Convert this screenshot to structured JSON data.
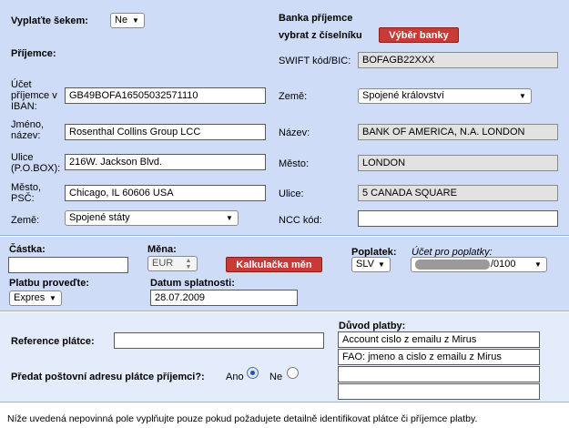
{
  "top": {
    "pay_by_check_label": "Vyplaťte šekem:",
    "pay_by_check_value": "Ne",
    "recipient_heading": "Příjemce:",
    "account_label": "Účet příjemce v IBAN:",
    "account_value": "GB49BOFA16505032571110",
    "name_label": "Jméno, název:",
    "name_value": "Rosenthal Collins Group LCC",
    "street_label": "Ulice (P.O.BOX):",
    "street_value": "216W. Jackson Blvd.",
    "city_label": "Město, PSČ:",
    "city_value": "Chicago, IL 60606 USA",
    "country_label": "Země:",
    "country_value": "Spojené státy"
  },
  "bank": {
    "heading_line1": "Banka příjemce",
    "heading_line2": "vybrat z číselníku",
    "select_bank_button": "Výběr banky",
    "swift_label": "SWIFT kód/BIC:",
    "swift_value": "BOFAGB22XXX",
    "country_label": "Země:",
    "country_value": "Spojené království",
    "name_label": "Název:",
    "name_value": "BANK OF AMERICA, N.A. LONDON",
    "city_label": "Město:",
    "city_value": "LONDON",
    "street_label": "Ulice:",
    "street_value": "5 CANADA SQUARE",
    "ncc_label": "NCC kód:",
    "ncc_value": ""
  },
  "amount": {
    "amount_label": "Částka:",
    "amount_value": "",
    "currency_label": "Měna:",
    "currency_value": "EUR",
    "calculator_button": "Kalkulačka měn",
    "fee_label": "Poplatek:",
    "fee_value": "SLV",
    "fee_account_label": "Účet pro poplatky:",
    "fee_account_value": "/0100",
    "execute_label": "Platbu proveďte:",
    "execute_value": "Expres",
    "due_date_label": "Datum splatnosti:",
    "due_date_value": "28.07.2009"
  },
  "reference": {
    "payer_ref_label": "Reference plátce:",
    "payer_ref_value": "",
    "reason_label": "Důvod platby:",
    "reason_lines": [
      "Account cislo z emailu z Mirus",
      "FAO: jmeno a cislo z emailu z Mirus",
      "",
      ""
    ],
    "pass_address_label": "Předat poštovní adresu plátce příjemci?:",
    "yes_label": "Ano",
    "no_label": "Ne",
    "selected": "Ano"
  },
  "footer": {
    "note": "Níže uvedená nepovinná pole vyplňujte pouze pokud požadujete detailně identifikovat plátce či příjemce platby."
  }
}
